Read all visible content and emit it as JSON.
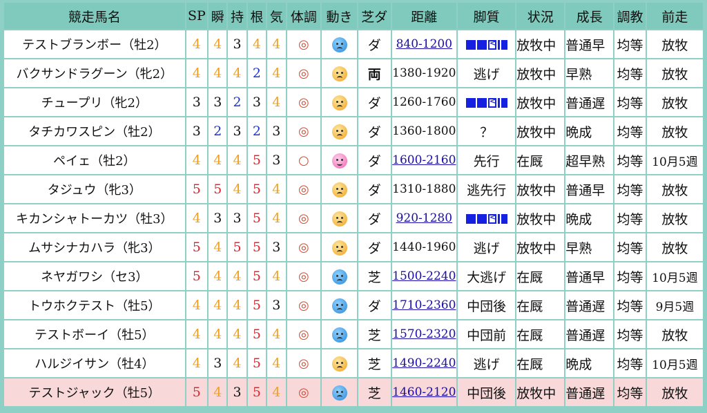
{
  "headers": [
    "競走馬名",
    "SP",
    "瞬",
    "持",
    "根",
    "気",
    "体調",
    "動き",
    "芝ダ",
    "距離",
    "脚質",
    "状況",
    "成長",
    "調教",
    "前走"
  ],
  "rows": [
    {
      "name": "テストブランボー（牡2）",
      "sp": "4",
      "shun": "4",
      "ji": "3",
      "kon": "4",
      "ki": "4",
      "cond": "◎",
      "move": "blue",
      "surface": "ダ",
      "dist": "840-1200",
      "dist_link": true,
      "style": "pattern",
      "status": "放牧中",
      "growth": "普通早",
      "train": "均等",
      "prev": "放牧"
    },
    {
      "name": "バクサンドラグーン（牝2）",
      "sp": "4",
      "shun": "4",
      "ji": "4",
      "kon": "2",
      "ki": "4",
      "cond": "◎",
      "move": "worried",
      "surface": "両",
      "dist": "1380-1920",
      "dist_link": false,
      "style": "逃げ",
      "status": "放牧中",
      "growth": "早熟",
      "train": "均等",
      "prev": "放牧"
    },
    {
      "name": "チュープリ（牝2）",
      "sp": "3",
      "shun": "3",
      "ji": "2",
      "kon": "3",
      "ki": "4",
      "cond": "◎",
      "move": "worried",
      "surface": "ダ",
      "dist": "1260-1760",
      "dist_link": false,
      "style": "pattern",
      "status": "放牧中",
      "growth": "普通遅",
      "train": "均等",
      "prev": "放牧"
    },
    {
      "name": "タチカワスピン（牡2）",
      "sp": "3",
      "shun": "2",
      "ji": "3",
      "kon": "2",
      "ki": "3",
      "cond": "◎",
      "move": "worried",
      "surface": "ダ",
      "dist": "1360-1800",
      "dist_link": false,
      "style": "？",
      "status": "放牧中",
      "growth": "晩成",
      "train": "均等",
      "prev": "放牧"
    },
    {
      "name": "ペイェ（牡2）",
      "sp": "4",
      "shun": "4",
      "ji": "4",
      "kon": "5",
      "ki": "3",
      "cond": "○",
      "move": "pink",
      "surface": "ダ",
      "dist": "1600-2160",
      "dist_link": true,
      "style": "先行",
      "status": "在厩",
      "growth": "超早熟",
      "train": "均等",
      "prev": "10月5週"
    },
    {
      "name": "タジュウ（牝3）",
      "sp": "5",
      "shun": "5",
      "ji": "4",
      "kon": "5",
      "ki": "4",
      "cond": "◎",
      "move": "worried",
      "surface": "ダ",
      "dist": "1310-1880",
      "dist_link": false,
      "style": "逃先行",
      "status": "放牧中",
      "growth": "普通早",
      "train": "均等",
      "prev": "放牧"
    },
    {
      "name": "キカンシャトーカツ（牡3）",
      "sp": "4",
      "shun": "3",
      "ji": "3",
      "kon": "5",
      "ki": "4",
      "cond": "◎",
      "move": "worried",
      "surface": "ダ",
      "dist": "920-1280",
      "dist_link": true,
      "style": "pattern",
      "status": "放牧中",
      "growth": "晩成",
      "train": "均等",
      "prev": "放牧"
    },
    {
      "name": "ムサシナカハラ（牝3）",
      "sp": "5",
      "shun": "4",
      "ji": "5",
      "kon": "5",
      "ki": "3",
      "cond": "◎",
      "move": "worried",
      "surface": "ダ",
      "dist": "1440-1960",
      "dist_link": false,
      "style": "逃げ",
      "status": "放牧中",
      "growth": "早熟",
      "train": "均等",
      "prev": "放牧"
    },
    {
      "name": "ネヤガワシ（セ3）",
      "sp": "5",
      "shun": "4",
      "ji": "4",
      "kon": "5",
      "ki": "4",
      "cond": "◎",
      "move": "blue",
      "surface": "芝",
      "dist": "1500-2240",
      "dist_link": true,
      "style": "大逃げ",
      "status": "在厩",
      "growth": "普通早",
      "train": "均等",
      "prev": "10月5週"
    },
    {
      "name": "トウホクテスト（牡5）",
      "sp": "4",
      "shun": "4",
      "ji": "4",
      "kon": "5",
      "ki": "3",
      "cond": "◎",
      "move": "blue",
      "surface": "ダ",
      "dist": "1710-2360",
      "dist_link": true,
      "style": "中団後",
      "status": "在厩",
      "growth": "普通遅",
      "train": "均等",
      "prev": "9月5週"
    },
    {
      "name": "テストボーイ（牡5）",
      "sp": "4",
      "shun": "4",
      "ji": "4",
      "kon": "5",
      "ki": "4",
      "cond": "◎",
      "move": "blue",
      "surface": "芝",
      "dist": "1570-2320",
      "dist_link": true,
      "style": "中団前",
      "status": "在厩",
      "growth": "普通遅",
      "train": "均等",
      "prev": "放牧"
    },
    {
      "name": "ハルジイサン（牡4）",
      "sp": "4",
      "shun": "3",
      "ji": "4",
      "kon": "5",
      "ki": "4",
      "cond": "◎",
      "move": "worried",
      "surface": "芝",
      "dist": "1490-2240",
      "dist_link": true,
      "style": "逃げ",
      "status": "在厩",
      "growth": "晩成",
      "train": "均等",
      "prev": "10月5週"
    },
    {
      "name": "テストジャック（牡5）",
      "sp": "5",
      "shun": "4",
      "ji": "3",
      "kon": "5",
      "ki": "4",
      "cond": "◎",
      "move": "blue",
      "surface": "芝",
      "dist": "1460-2120",
      "dist_link": true,
      "style": "中団後",
      "status": "放牧中",
      "growth": "普通遅",
      "train": "均等",
      "prev": "放牧",
      "highlight": true
    }
  ]
}
